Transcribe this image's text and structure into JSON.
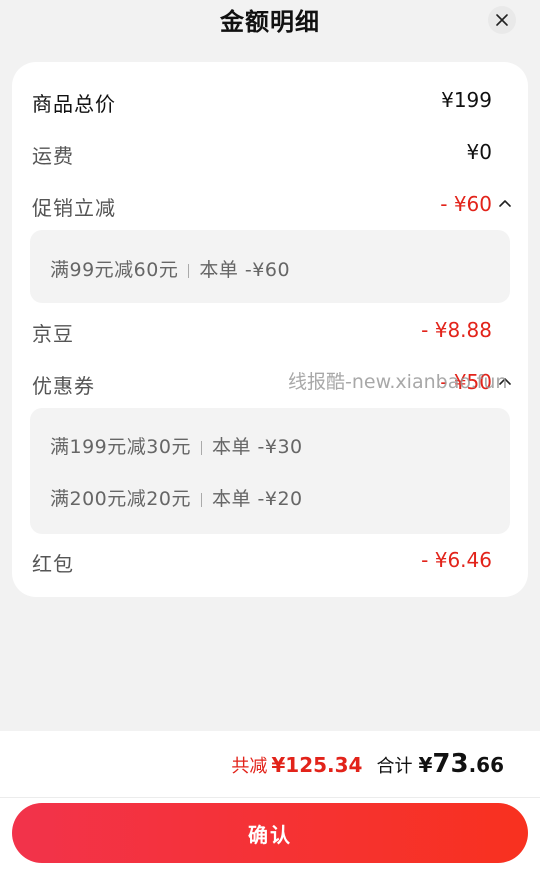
{
  "header": {
    "title": "金额明细",
    "close_icon": "close-icon"
  },
  "rows": {
    "goods_total": {
      "label": "商品总价",
      "value": "¥199"
    },
    "shipping": {
      "label": "运费",
      "value": "¥0"
    },
    "promo": {
      "label": "促销立减",
      "value": "- ¥60",
      "expanded": true,
      "details": [
        {
          "text": "满99元减60元",
          "scope": "本单",
          "amount": "-¥60"
        }
      ]
    },
    "jingdou": {
      "label": "京豆",
      "value": "- ¥8.88"
    },
    "coupon": {
      "label": "优惠券",
      "value": "- ¥50",
      "expanded": true,
      "details": [
        {
          "text": "满199元减30元",
          "scope": "本单",
          "amount": "-¥30"
        },
        {
          "text": "满200元减20元",
          "scope": "本单",
          "amount": "-¥20"
        }
      ]
    },
    "redpacket": {
      "label": "红包",
      "value": "- ¥6.46"
    }
  },
  "watermark": "线报酷-new.xianbao.fun",
  "summary": {
    "reduce_label": "共减",
    "reduce_value": "¥125.34",
    "total_label": "合计",
    "total_currency": "¥",
    "total_integer": "73",
    "total_decimal": ".66"
  },
  "confirm_button": "确认",
  "colors": {
    "accent_red": "#e2231a",
    "button_start": "#f2334b",
    "button_end": "#f8311f",
    "background": "#f2f2f2"
  }
}
